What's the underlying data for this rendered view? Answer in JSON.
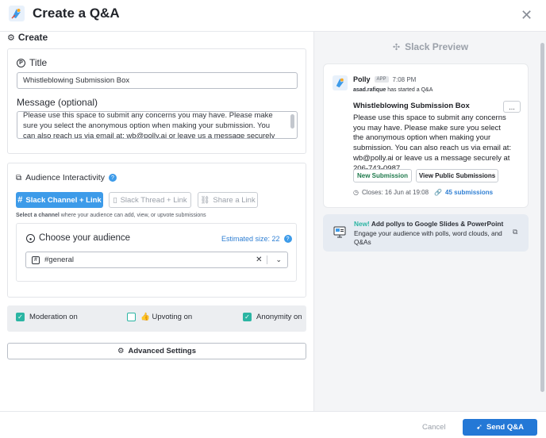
{
  "header": {
    "title": "Create a Q&A",
    "close_icon": "close-icon"
  },
  "create": {
    "section_label": "Create",
    "title_label": "Title",
    "title_value": "Whistleblowing Submission Box",
    "message_label": "Message (optional)",
    "message_value": "Please use this space to submit any concerns you may have. Please make sure you select the anonymous option when making your submission. You can also reach us via email at: wb@polly.ai or leave us a message securely at 206-743-0987"
  },
  "audience": {
    "section_label": "Audience Interactivity",
    "options": [
      {
        "label": "Slack Channel + Link",
        "active": true
      },
      {
        "label": "Slack Thread + Link",
        "active": false
      },
      {
        "label": "Share a Link",
        "active": false
      }
    ],
    "hint_bold": "Select a channel",
    "hint_rest": " where your audience can add, view, or upvote submissions",
    "choose_label": "Choose your audience",
    "estimated_size": "Estimated size: 22",
    "channel_value": "#general"
  },
  "toggles": {
    "moderation": {
      "label": "Moderation on",
      "checked": true
    },
    "upvoting": {
      "label": "👍 Upvoting on",
      "checked": false
    },
    "anonymity": {
      "label": "Anonymity on",
      "checked": true
    }
  },
  "advanced_label": "Advanced Settings",
  "footer": {
    "cancel": "Cancel",
    "send": "Send Q&A"
  },
  "preview": {
    "title": "Slack Preview",
    "sender": "Polly",
    "app_tag": "APP",
    "time": "7:08 PM",
    "starter_name": "asad.rafique",
    "starter_rest": " has started a Q&A",
    "heading": "Whistleblowing Submission Box",
    "more_label": "...",
    "body": "Please use this space to submit any concerns you may have. Please make sure you select the anonymous option when making your submission. You can also reach us via email at: wb@polly.ai or leave us a message securely at 206-743-0987",
    "new_submission": "New Submission",
    "view_public": "View Public Submissions",
    "closes": "Closes: 16 Jun at 19:08",
    "submissions": "45 submissions"
  },
  "promo": {
    "new_label": "New!",
    "line1": " Add pollys to Google Slides & PowerPoint",
    "line2": "Engage your audience with polls, word clouds, and Q&As"
  },
  "colors": {
    "accent": "#3d9be9",
    "send": "#2478d6",
    "teal": "#2bb5a3",
    "green_text": "#1f7a4c"
  }
}
